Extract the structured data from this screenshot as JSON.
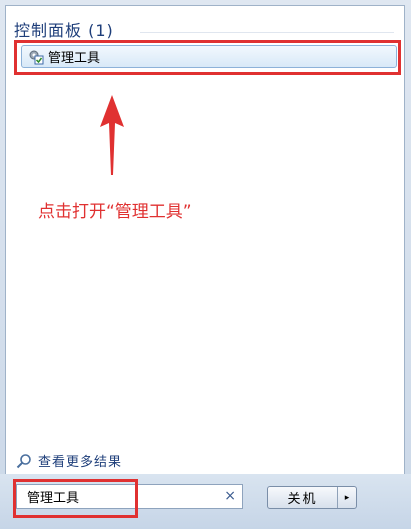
{
  "results": {
    "section_title": "控制面板 (1)",
    "items": [
      {
        "label": "管理工具"
      }
    ]
  },
  "annotation": {
    "text": "点击打开“管理工具”",
    "color": "#e03131"
  },
  "see_more": {
    "label": "查看更多结果"
  },
  "search": {
    "value": "管理工具",
    "clear_glyph": "×"
  },
  "shutdown": {
    "label": "关机",
    "arrow_glyph": "▸"
  },
  "colors": {
    "accent": "#1e3e7a",
    "highlight": "#e03131"
  }
}
